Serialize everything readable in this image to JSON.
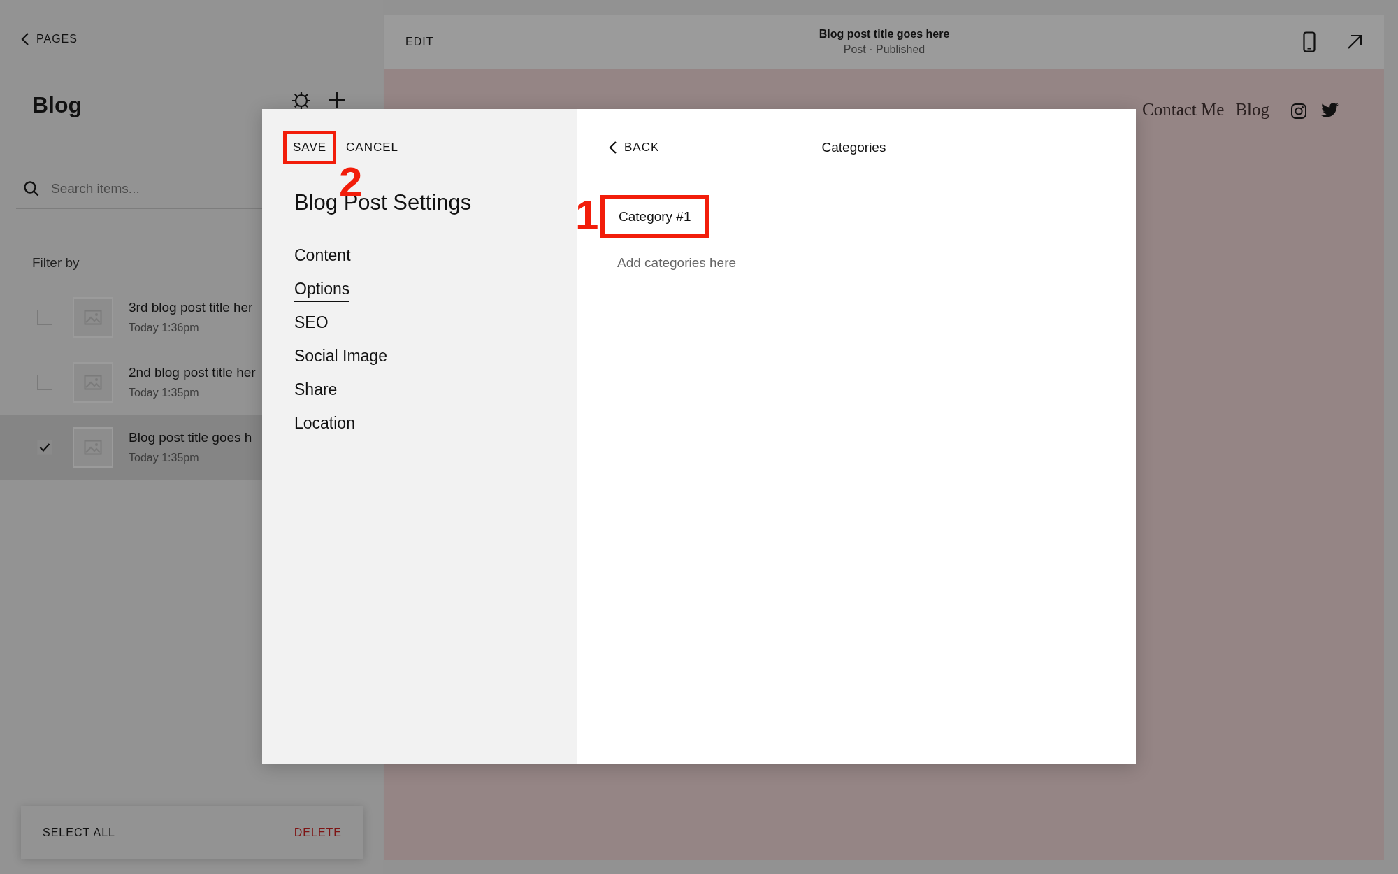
{
  "sidebar": {
    "back_link": "PAGES",
    "title": "Blog",
    "search": {
      "placeholder": "Search items..."
    },
    "filter_label": "Filter by",
    "posts": [
      {
        "title": "3rd blog post title her",
        "time": "Today 1:36pm",
        "checked": false,
        "selected": false
      },
      {
        "title": "2nd blog post title her",
        "time": "Today 1:35pm",
        "checked": false,
        "selected": false
      },
      {
        "title": "Blog post title goes h",
        "time": "Today 1:35pm",
        "checked": true,
        "selected": true
      }
    ],
    "select_all": "SELECT ALL",
    "delete": "DELETE"
  },
  "preview": {
    "edit_label": "EDIT",
    "post_title": "Blog post title goes here",
    "post_status": "Post · Published",
    "nav": [
      {
        "label": "Contact Me",
        "selected": false
      },
      {
        "label": "Blog",
        "selected": true
      }
    ]
  },
  "modal": {
    "save": {
      "label": "SAVE",
      "callout": "2"
    },
    "cancel": "CANCEL",
    "title": "Blog Post Settings",
    "menu": [
      {
        "label": "Content",
        "selected": false
      },
      {
        "label": "Options",
        "selected": true
      },
      {
        "label": "SEO",
        "selected": false
      },
      {
        "label": "Social Image",
        "selected": false
      },
      {
        "label": "Share",
        "selected": false
      },
      {
        "label": "Location",
        "selected": false
      }
    ],
    "back": "BACK",
    "panel_title": "Categories",
    "categories": [
      {
        "label": "Category #1",
        "callout": "1"
      }
    ],
    "new_category": {
      "placeholder": "Add categories here"
    }
  }
}
